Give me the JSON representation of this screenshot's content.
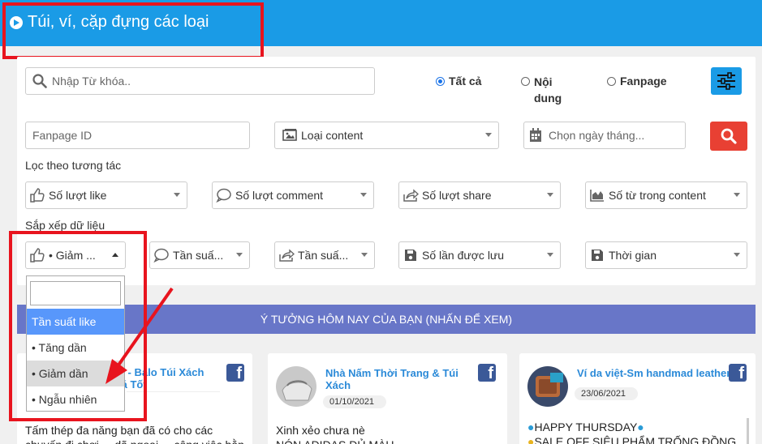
{
  "header": {
    "title": "Túi, ví, cặp đựng các loại"
  },
  "search": {
    "placeholder": "Nhập Từ khóa.."
  },
  "scope_radios": {
    "all": "Tất cả",
    "content": "Nội dung",
    "fanpage": "Fanpage",
    "selected": "all"
  },
  "filters": {
    "fanpage_id_placeholder": "Fanpage ID",
    "content_type": "Loại content",
    "date_placeholder": "Chọn ngày tháng..."
  },
  "interaction_filter": {
    "label": "Lọc theo tương tác",
    "likes": "Số lượt like",
    "comments": "Số lượt comment",
    "shares": "Số lượt share",
    "words": "Số từ trong content"
  },
  "sort": {
    "label": "Sắp xếp dữ liệu",
    "like_sort": "• Giảm ...",
    "comment_sort": "Tần suấ...",
    "share_sort": "Tần suấ...",
    "saves": "Số lần được lưu",
    "time": "Thời gian"
  },
  "sort_dropdown": {
    "search_value": "",
    "options": [
      "Tần suất like",
      "• Tăng dần",
      "• Giảm dần",
      "• Ngẫu nhiên"
    ],
    "highlighted": "Tần suất like",
    "hovered": "• Giảm dần"
  },
  "banner": {
    "text": "Ý TƯỞNG HÔM NAY CỦA BẠN (NHẤN ĐỂ XEM)"
  },
  "cards": [
    {
      "name_line1": "n - Balo Túi Xách",
      "name_line2": "iá Tốt",
      "date": "",
      "text_line1": "Tấm thép đa năng bạn đã có cho các",
      "text_line2": "chuyến đi chơi ... dã ngoại ... công việc hằng ngày"
    },
    {
      "name_line1": "Nhà Nấm Thời Trang & Túi",
      "name_line2": "Xách",
      "date": "01/10/2021",
      "text_line1": "Xinh xẻo chưa nè",
      "text_line2": "NÓN ADIDAS ĐỦ MÀU"
    },
    {
      "name_line1": "Ví da việt-Sm handmad leather",
      "name_line2": "",
      "date": "23/06/2021",
      "text_line1": "HAPPY THURSDAY",
      "text_line2": "SALE OFF SIÊU PHẨM TRỐNG ĐỒNG"
    }
  ],
  "icons": {
    "title": "play-circle-icon",
    "search": "magnifier-icon",
    "filter": "sliders-icon",
    "search_button": "magnifier-icon",
    "content_type": "image-icon",
    "date": "calendar-icon",
    "like": "thumbs-up-icon",
    "comment": "speech-bubble-icon",
    "share": "share-arrow-icon",
    "words": "area-chart-icon",
    "save": "floppy-disk-icon",
    "facebook": "facebook-icon"
  },
  "colors": {
    "header": "#1a9be6",
    "search_button": "#e84033",
    "banner": "#6876c8",
    "annotation": "#e8141e",
    "dropdown_highlight": "#5897fb",
    "link": "#2b8ad8"
  }
}
